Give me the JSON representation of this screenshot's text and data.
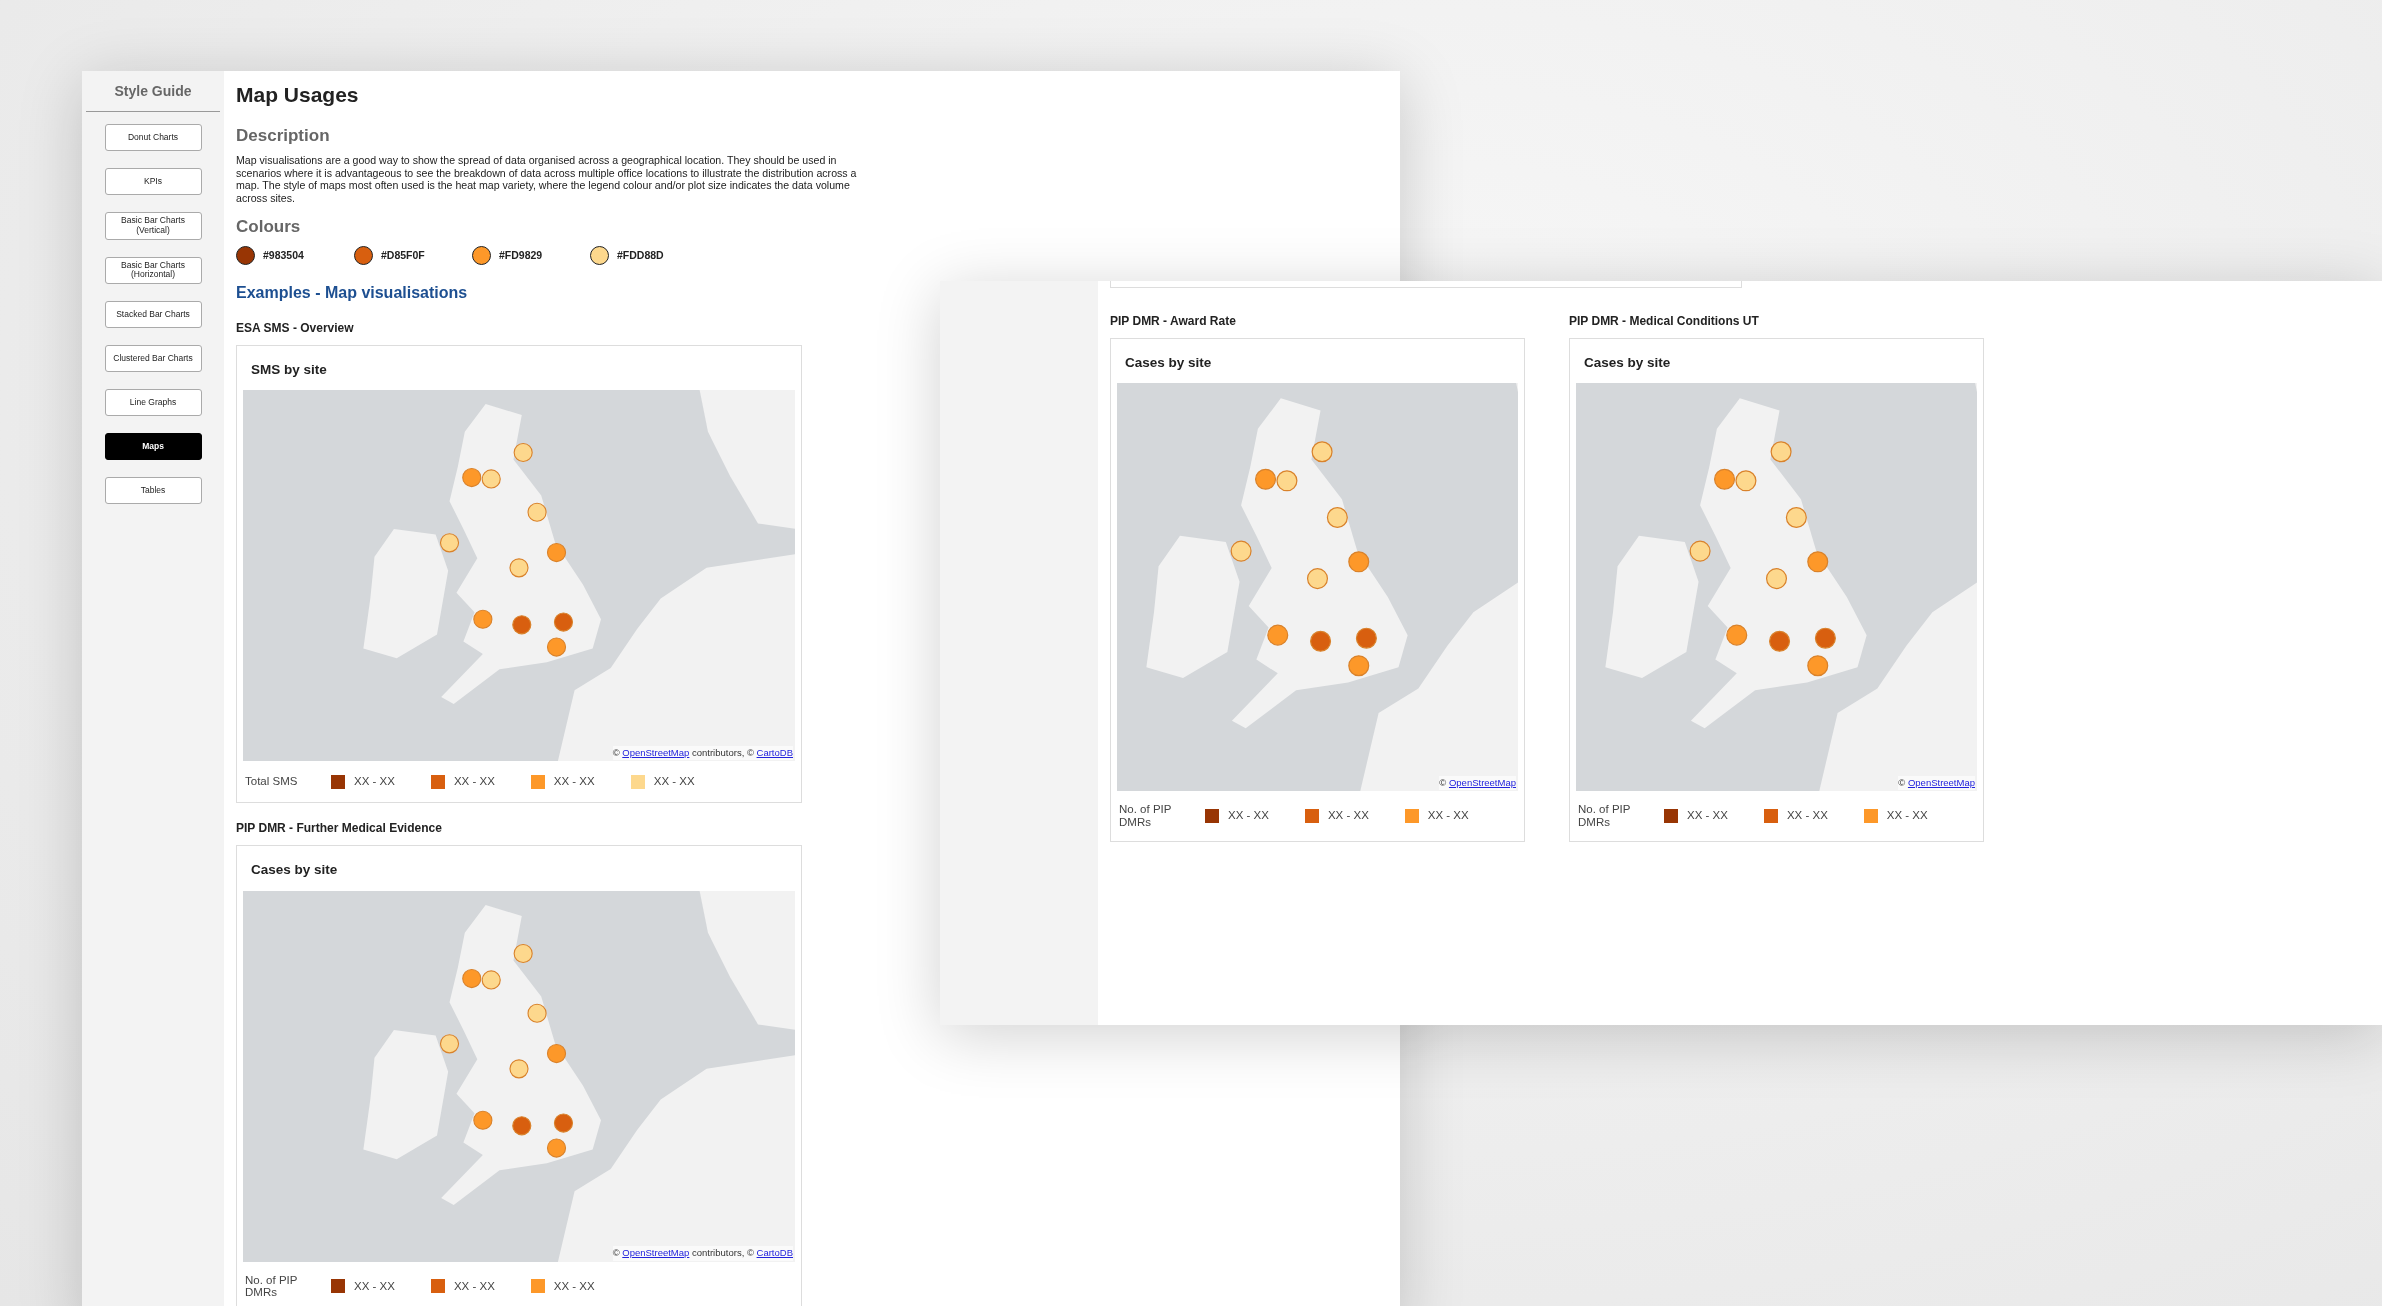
{
  "left_window": {
    "sidebar": {
      "title": "Style Guide",
      "items": [
        {
          "label": "Donut Charts",
          "selected": false
        },
        {
          "label": "KPIs",
          "selected": false
        },
        {
          "label": "Basic Bar Charts (Vertical)",
          "selected": false
        },
        {
          "label": "Basic Bar Charts (Horizontal)",
          "selected": false
        },
        {
          "label": "Stacked Bar Charts",
          "selected": false
        },
        {
          "label": "Clustered Bar Charts",
          "selected": false
        },
        {
          "label": "Line Graphs",
          "selected": false
        },
        {
          "label": "Maps",
          "selected": true
        },
        {
          "label": "Tables",
          "selected": false
        }
      ]
    },
    "page_title": "Map Usages",
    "description": {
      "heading": "Description",
      "text": "Map visualisations are a good way to show the spread of data organised across a geographical location. They should be used in scenarios where it is advantageous to see the breakdown of data across multiple office locations to illustrate the distribution across a map.  The style of maps most often used is the heat map variety, where the legend colour and/or plot size indicates the data volume across sites."
    },
    "colours": {
      "heading": "Colours",
      "swatches": [
        {
          "label": "#983504",
          "color": "#983504"
        },
        {
          "label": "#D85F0F",
          "color": "#d85f0f"
        },
        {
          "label": "#FD9829",
          "color": "#fd9829"
        },
        {
          "label": "#FDD88D",
          "color": "#fdd88d"
        }
      ]
    },
    "examples_heading": "Examples - Map visualisations",
    "sections": [
      {
        "title": "ESA SMS - Overview",
        "card_title": "SMS by site",
        "attribution": [
          {
            "kind": "text",
            "text": "© "
          },
          {
            "kind": "link",
            "text": "OpenStreetMap"
          },
          {
            "kind": "text",
            "text": " contributors, © "
          },
          {
            "kind": "link",
            "text": "CartoDB"
          }
        ],
        "legend": {
          "label": "Total SMS",
          "items": [
            {
              "label": "XX - XX",
              "color": "#983504"
            },
            {
              "label": "XX - XX",
              "color": "#d85f0f"
            },
            {
              "label": "XX - XX",
              "color": "#fd9829"
            },
            {
              "label": "XX - XX",
              "color": "#fdd88d"
            }
          ]
        }
      },
      {
        "title": "PIP DMR - Further Medical Evidence",
        "card_title": "Cases by site",
        "attribution": [
          {
            "kind": "text",
            "text": "© "
          },
          {
            "kind": "link",
            "text": "OpenStreetMap"
          },
          {
            "kind": "text",
            "text": " contributors, © "
          },
          {
            "kind": "link",
            "text": "CartoDB"
          }
        ],
        "legend": {
          "label": "No. of PIP DMRs",
          "items": [
            {
              "label": "XX - XX",
              "color": "#983504"
            },
            {
              "label": "XX - XX",
              "color": "#d85f0f"
            },
            {
              "label": "XX - XX",
              "color": "#fd9829"
            }
          ]
        }
      }
    ]
  },
  "right_window": {
    "sections": [
      {
        "title": "PIP DMR - Award Rate",
        "card_title": "Cases by site",
        "attribution": [
          {
            "kind": "text",
            "text": "© "
          },
          {
            "kind": "link",
            "text": "OpenStreetMap"
          }
        ],
        "legend": {
          "label": "No. of PIP DMRs",
          "items": [
            {
              "label": "XX - XX",
              "color": "#983504"
            },
            {
              "label": "XX - XX",
              "color": "#d85f0f"
            },
            {
              "label": "XX - XX",
              "color": "#fd9829"
            }
          ]
        }
      },
      {
        "title": "PIP DMR - Medical Conditions UT",
        "card_title": "Cases by site",
        "attribution": [
          {
            "kind": "text",
            "text": "© "
          },
          {
            "kind": "link",
            "text": "OpenStreetMap"
          }
        ],
        "legend": {
          "label": "No. of PIP DMRs",
          "items": [
            {
              "label": "XX - XX",
              "color": "#983504"
            },
            {
              "label": "XX - XX",
              "color": "#d85f0f"
            },
            {
              "label": "XX - XX",
              "color": "#fd9829"
            }
          ]
        }
      }
    ]
  }
}
